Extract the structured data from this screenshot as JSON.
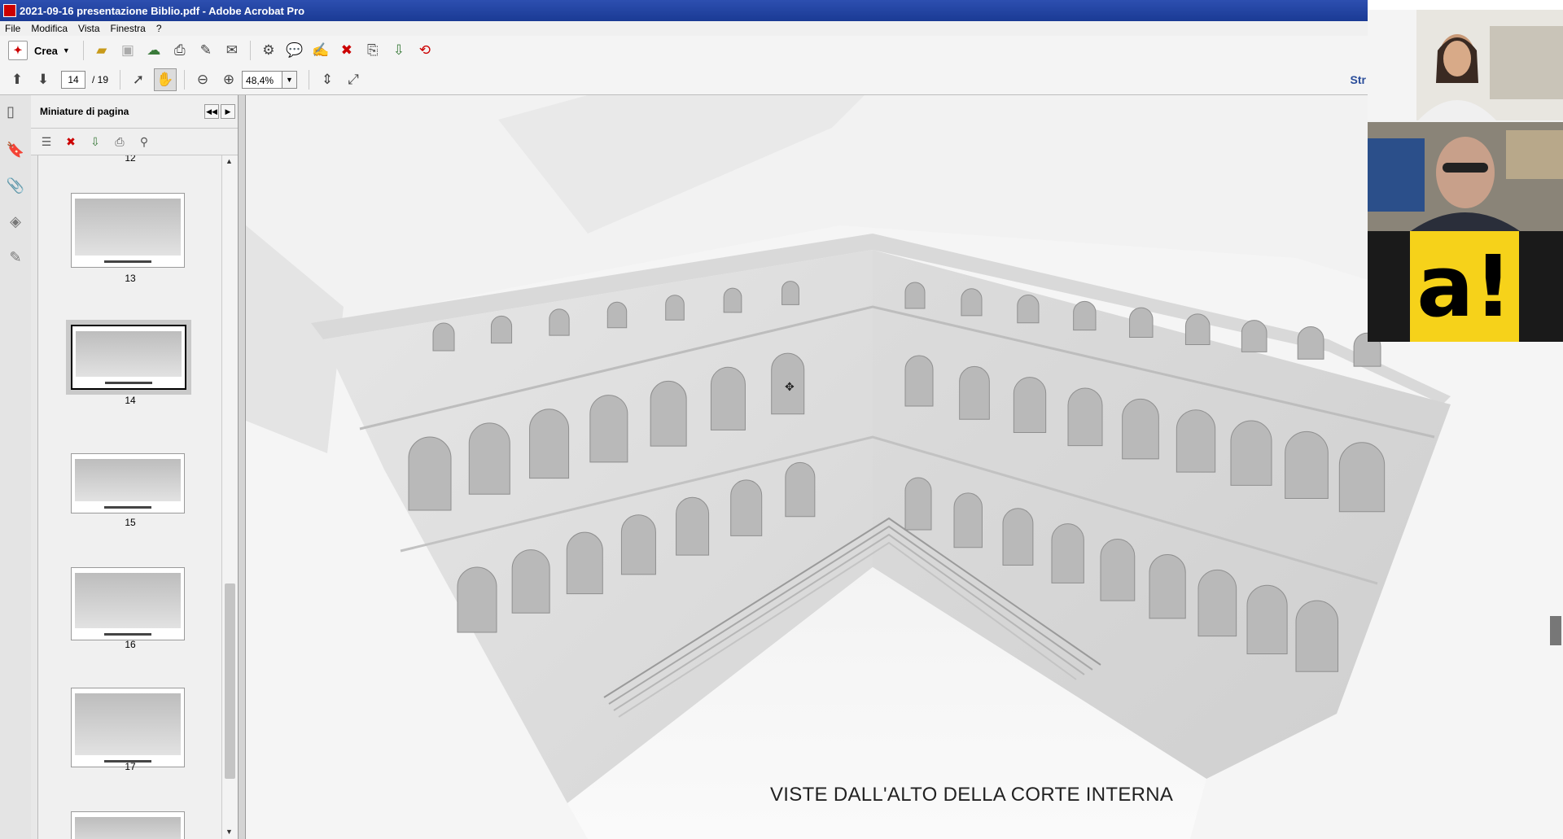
{
  "window": {
    "title": "2021-09-16 presentazione Biblio.pdf - Adobe Acrobat Pro"
  },
  "menu": [
    "File",
    "Modifica",
    "Vista",
    "Finestra",
    "?"
  ],
  "toolbar": {
    "create_label": "Crea",
    "page_current": "14",
    "page_total": "/ 19",
    "zoom": "48,4%",
    "right_link": "Str"
  },
  "panel": {
    "title": "Miniature di pagina",
    "thumbnails": [
      {
        "label": "12"
      },
      {
        "label": "13"
      },
      {
        "label": "14",
        "selected": true
      },
      {
        "label": "15"
      },
      {
        "label": "16"
      },
      {
        "label": "17"
      }
    ]
  },
  "document": {
    "caption": "VISTE DALL'ALTO DELLA CORTE INTERNA"
  },
  "video_call": {
    "logo_text": "a!",
    "logo_color": "#f6d21a"
  }
}
